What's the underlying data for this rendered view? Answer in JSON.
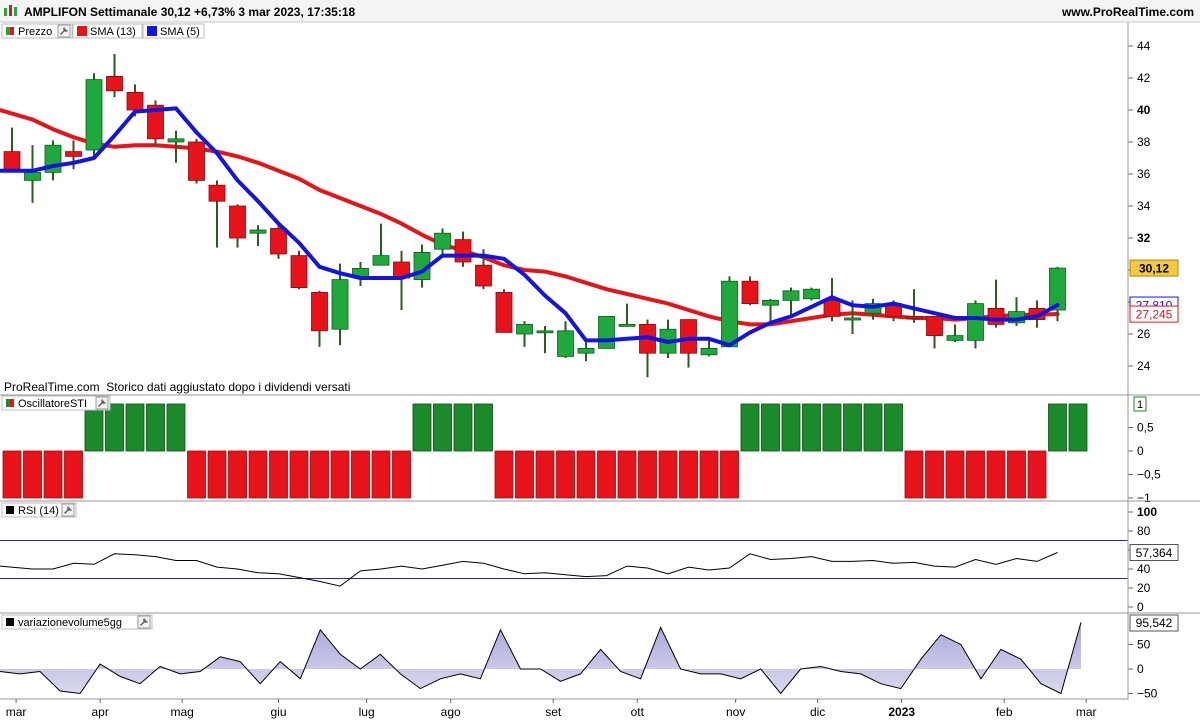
{
  "header": {
    "title": "AMPLIFON Settimanale 30,12 +6,73% 3 mar 2023, 17:35:18",
    "website": "www.ProRealTime.com"
  },
  "price_panel": {
    "legend": [
      {
        "name": "Prezzo",
        "icon": "candle-icon",
        "has_wrench": true
      },
      {
        "name": "SMA (13)",
        "color": "#e8131a",
        "has_wrench": false
      },
      {
        "name": "SMA (5)",
        "color": "#1414e0",
        "has_wrench": false
      }
    ],
    "note": "ProRealTime.com  Storico dati aggiustato dopo i dividendi versati",
    "y_ticks": [
      24,
      26,
      28,
      30,
      32,
      34,
      36,
      38,
      40,
      42,
      44
    ],
    "badges": [
      {
        "text": "30,12",
        "value": 30.12,
        "bg": "#f5c842",
        "fg": "#000000",
        "border": "#b08a00"
      },
      {
        "text": "27,810",
        "value": 27.81,
        "bg": "#ffffff",
        "fg": "#1414e0",
        "border": "#1414e0"
      },
      {
        "text": "27,245",
        "value": 27.245,
        "bg": "#ffffff",
        "fg": "#e8131a",
        "border": "#e8131a"
      }
    ]
  },
  "osc_panel": {
    "title": "OscillatoreSTI",
    "y_ticks": [
      "0,5",
      "0",
      "−0,5",
      "−1"
    ],
    "badge": "1"
  },
  "rsi_panel": {
    "title": "RSI (14)",
    "y_ticks": [
      "100",
      "80",
      "60",
      "40",
      "20",
      "0"
    ],
    "badge": "57,364",
    "upper_level": 70,
    "lower_level": 30
  },
  "vol_panel": {
    "title": "variazionevolume5gg",
    "y_ticks": [
      "50",
      "0",
      "−50"
    ],
    "badge": "95,542"
  },
  "x_axis": {
    "labels": [
      {
        "text": "mar",
        "week": 1.2,
        "bold": false
      },
      {
        "text": "apr",
        "week": 5.3,
        "bold": false
      },
      {
        "text": "mag",
        "week": 9.3,
        "bold": false
      },
      {
        "text": "giu",
        "week": 14,
        "bold": false
      },
      {
        "text": "lug",
        "week": 18.3,
        "bold": false
      },
      {
        "text": "ago",
        "week": 22.4,
        "bold": false
      },
      {
        "text": "set",
        "week": 27.4,
        "bold": false
      },
      {
        "text": "ott",
        "week": 31.5,
        "bold": false
      },
      {
        "text": "nov",
        "week": 36.3,
        "bold": false
      },
      {
        "text": "dic",
        "week": 40.3,
        "bold": false
      },
      {
        "text": "2023",
        "week": 44.4,
        "bold": true
      },
      {
        "text": "feb",
        "week": 49.4,
        "bold": false
      },
      {
        "text": "mar",
        "week": 53.4,
        "bold": false
      }
    ]
  },
  "colors": {
    "up": "#1fa83c",
    "down": "#e8131a",
    "up_dark": "#0d5f1c",
    "down_dark": "#8a0a0a",
    "wick": "#2e5a1e",
    "sma13": "#e8131a",
    "sma5": "#1414e0",
    "osc_up": "#1a8a2a",
    "osc_down": "#e8131a",
    "rsi_line": "#000000",
    "rsi_levels": "#2a2aa0",
    "vol_fill": "#c9c8e6",
    "vol_line": "#000000"
  },
  "chart_data": [
    {
      "type": "candlestick",
      "title": "AMPLIFON Settimanale",
      "x_unit": "week",
      "candles": [
        {
          "o": 37.4,
          "h": 38.9,
          "l": 36.3,
          "c": 36.3
        },
        {
          "o": 35.6,
          "h": 37.8,
          "l": 34.2,
          "c": 36.1
        },
        {
          "o": 36.1,
          "h": 38.1,
          "l": 35.6,
          "c": 37.8
        },
        {
          "o": 37.4,
          "h": 38.1,
          "l": 36.3,
          "c": 37.1
        },
        {
          "o": 37.5,
          "h": 42.3,
          "l": 37.0,
          "c": 41.9
        },
        {
          "o": 42.1,
          "h": 43.5,
          "l": 40.8,
          "c": 41.2
        },
        {
          "o": 41.1,
          "h": 41.6,
          "l": 39.6,
          "c": 40.0
        },
        {
          "o": 40.3,
          "h": 40.6,
          "l": 37.8,
          "c": 38.2
        },
        {
          "o": 38.0,
          "h": 38.7,
          "l": 36.7,
          "c": 38.2
        },
        {
          "o": 38.0,
          "h": 38.2,
          "l": 35.4,
          "c": 35.6
        },
        {
          "o": 35.3,
          "h": 35.6,
          "l": 31.4,
          "c": 34.3
        },
        {
          "o": 34.0,
          "h": 34.1,
          "l": 31.4,
          "c": 32.0
        },
        {
          "o": 32.3,
          "h": 32.8,
          "l": 31.5,
          "c": 32.5
        },
        {
          "o": 32.6,
          "h": 32.8,
          "l": 30.7,
          "c": 31.0
        },
        {
          "o": 30.9,
          "h": 31.2,
          "l": 28.8,
          "c": 28.9
        },
        {
          "o": 28.6,
          "h": 28.7,
          "l": 25.2,
          "c": 26.2
        },
        {
          "o": 26.3,
          "h": 30.4,
          "l": 25.3,
          "c": 29.4
        },
        {
          "o": 29.6,
          "h": 30.5,
          "l": 29.0,
          "c": 30.1
        },
        {
          "o": 30.3,
          "h": 32.9,
          "l": 30.3,
          "c": 30.9
        },
        {
          "o": 30.5,
          "h": 31.2,
          "l": 27.5,
          "c": 29.5
        },
        {
          "o": 29.4,
          "h": 31.6,
          "l": 28.9,
          "c": 31.1
        },
        {
          "o": 31.3,
          "h": 32.6,
          "l": 30.8,
          "c": 32.3
        },
        {
          "o": 31.9,
          "h": 32.4,
          "l": 30.2,
          "c": 30.5
        },
        {
          "o": 30.3,
          "h": 31.3,
          "l": 28.8,
          "c": 29.0
        },
        {
          "o": 28.6,
          "h": 28.8,
          "l": 26.1,
          "c": 26.1
        },
        {
          "o": 26.0,
          "h": 26.8,
          "l": 25.2,
          "c": 26.6
        },
        {
          "o": 26.2,
          "h": 26.5,
          "l": 24.8,
          "c": 26.2
        },
        {
          "o": 24.6,
          "h": 26.8,
          "l": 24.5,
          "c": 26.2
        },
        {
          "o": 24.8,
          "h": 25.6,
          "l": 24.3,
          "c": 25.1
        },
        {
          "o": 25.1,
          "h": 27.1,
          "l": 25.1,
          "c": 27.1
        },
        {
          "o": 26.6,
          "h": 27.9,
          "l": 26.6,
          "c": 26.6
        },
        {
          "o": 26.6,
          "h": 26.9,
          "l": 23.3,
          "c": 24.8
        },
        {
          "o": 24.8,
          "h": 26.9,
          "l": 24.5,
          "c": 26.3
        },
        {
          "o": 26.9,
          "h": 26.9,
          "l": 23.9,
          "c": 24.8
        },
        {
          "o": 24.7,
          "h": 25.6,
          "l": 24.6,
          "c": 25.1
        },
        {
          "o": 25.2,
          "h": 29.6,
          "l": 25.2,
          "c": 29.3
        },
        {
          "o": 29.3,
          "h": 29.6,
          "l": 27.8,
          "c": 27.9
        },
        {
          "o": 27.8,
          "h": 28.2,
          "l": 26.7,
          "c": 28.1
        },
        {
          "o": 28.1,
          "h": 28.9,
          "l": 27.0,
          "c": 28.7
        },
        {
          "o": 28.2,
          "h": 28.9,
          "l": 28.1,
          "c": 28.8
        },
        {
          "o": 28.1,
          "h": 29.5,
          "l": 26.8,
          "c": 27.1
        },
        {
          "o": 27.0,
          "h": 28.1,
          "l": 26.0,
          "c": 27.0
        },
        {
          "o": 27.3,
          "h": 28.2,
          "l": 26.9,
          "c": 27.9
        },
        {
          "o": 27.9,
          "h": 28.1,
          "l": 26.8,
          "c": 27.1
        },
        {
          "o": 27.1,
          "h": 28.8,
          "l": 26.7,
          "c": 27.0
        },
        {
          "o": 27.1,
          "h": 27.1,
          "l": 25.1,
          "c": 25.9
        },
        {
          "o": 25.6,
          "h": 26.6,
          "l": 25.5,
          "c": 25.9
        },
        {
          "o": 25.6,
          "h": 28.1,
          "l": 25.1,
          "c": 27.9
        },
        {
          "o": 27.6,
          "h": 29.4,
          "l": 26.4,
          "c": 26.6
        },
        {
          "o": 26.7,
          "h": 28.3,
          "l": 26.5,
          "c": 27.4
        },
        {
          "o": 27.6,
          "h": 28.1,
          "l": 26.4,
          "c": 26.9
        },
        {
          "o": 27.5,
          "h": 30.2,
          "l": 26.8,
          "c": 30.12
        }
      ],
      "sma13": [
        40.0,
        39.4,
        38.8,
        38.3,
        37.9,
        37.7,
        37.8,
        37.8,
        37.7,
        37.6,
        37.4,
        37.1,
        36.7,
        36.2,
        35.7,
        35.0,
        34.5,
        34.0,
        33.5,
        32.9,
        32.2,
        31.6,
        31.2,
        30.8,
        30.3,
        30.0,
        29.9,
        29.6,
        29.2,
        28.8,
        28.5,
        28.2,
        27.9,
        27.5,
        27.1,
        26.8,
        26.6,
        26.6,
        26.8,
        27.0,
        27.2,
        27.3,
        27.2,
        27.1,
        27.0,
        27.0,
        26.9,
        27.0,
        27.1,
        27.2,
        27.2,
        27.25
      ],
      "sma5": [
        36.2,
        36.2,
        36.5,
        36.7,
        37.0,
        38.4,
        39.9,
        40.0,
        40.1,
        38.6,
        37.3,
        35.6,
        34.3,
        32.9,
        31.7,
        30.2,
        29.8,
        29.5,
        29.5,
        29.5,
        29.9,
        30.9,
        30.9,
        30.9,
        30.7,
        29.7,
        28.4,
        27.3,
        25.6,
        25.6,
        25.7,
        25.8,
        25.5,
        25.7,
        25.7,
        25.3,
        26.1,
        26.7,
        27.1,
        27.7,
        28.3,
        27.8,
        27.7,
        27.9,
        27.6,
        27.3,
        27.0,
        27.0,
        26.9,
        26.9,
        27.1,
        27.81
      ]
    },
    {
      "type": "bar",
      "title": "OscillatoreSTI",
      "x_unit": "week",
      "values": [
        -1,
        -1,
        -1,
        -1,
        1,
        1,
        1,
        1,
        1,
        -1,
        -1,
        -1,
        -1,
        -1,
        -1,
        -1,
        -1,
        -1,
        -1,
        -1,
        1,
        1,
        1,
        1,
        -1,
        -1,
        -1,
        -1,
        -1,
        -1,
        -1,
        -1,
        -1,
        -1,
        -1,
        -1,
        1,
        1,
        1,
        1,
        1,
        1,
        1,
        1,
        -1,
        -1,
        -1,
        -1,
        -1,
        -1,
        -1,
        1,
        1
      ],
      "ylim": [
        -1,
        1
      ]
    },
    {
      "type": "line",
      "title": "RSI (14)",
      "x_unit": "week",
      "values": [
        43,
        40,
        40,
        46,
        45,
        56,
        55,
        53,
        49,
        49,
        42,
        40,
        36,
        35,
        31,
        27,
        22,
        38,
        40,
        43,
        40,
        44,
        48,
        46,
        40,
        35,
        36,
        34,
        32,
        33,
        43,
        41,
        35,
        42,
        39,
        41,
        56,
        50,
        51,
        53,
        48,
        48,
        49,
        46,
        47,
        43,
        42,
        50,
        45,
        51,
        48,
        57.364
      ],
      "ylim": [
        0,
        100
      ],
      "levels": [
        70,
        30
      ]
    },
    {
      "type": "area",
      "title": "variazionevolume5gg",
      "x_unit": "week",
      "values": [
        -5,
        -10,
        -5,
        -45,
        -50,
        10,
        -15,
        -30,
        5,
        -10,
        -5,
        25,
        15,
        -30,
        15,
        -20,
        80,
        30,
        0,
        30,
        -10,
        -40,
        -20,
        -10,
        -20,
        80,
        0,
        0,
        -25,
        -10,
        40,
        -5,
        -20,
        85,
        0,
        -10,
        -10,
        -20,
        0,
        -50,
        0,
        5,
        -5,
        -10,
        -30,
        -40,
        20,
        70,
        50,
        -20,
        40,
        20,
        -30,
        -50,
        95.542
      ],
      "ylim": [
        -55,
        95
      ]
    }
  ]
}
